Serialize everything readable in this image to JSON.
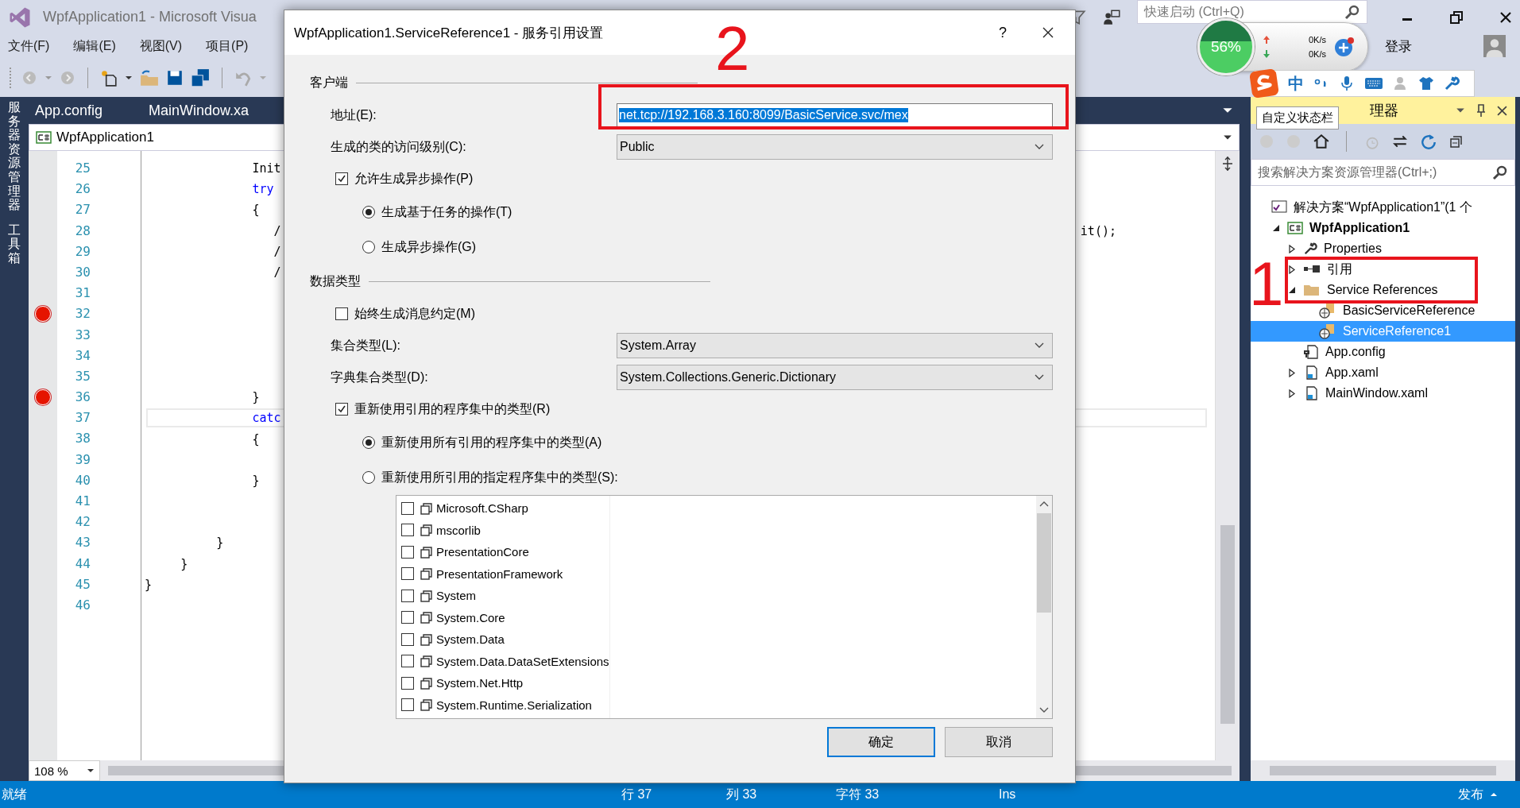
{
  "window": {
    "title": "WpfApplication1 - Microsoft Visua",
    "quick_launch": {
      "placeholder": "快速启动 (Ctrl+Q)"
    },
    "sign_in": "登录"
  },
  "menu": [
    "文件(F)",
    "编辑(E)",
    "视图(V)",
    "项目(P)"
  ],
  "side_tabs": [
    "服务器资源管理器",
    "工具箱"
  ],
  "editor": {
    "tabs": [
      "App.config",
      "MainWindow.xa"
    ],
    "breadcrumb": "WpfApplication1",
    "zoom": "108 %",
    "lines": [
      {
        "number": "25",
        "code": "               Init",
        "breakpoint": false
      },
      {
        "number": "26",
        "code": "               try",
        "keyword": true,
        "breakpoint": false
      },
      {
        "number": "27",
        "code": "               {",
        "breakpoint": false
      },
      {
        "number": "28",
        "code": "                  /",
        "tail": "it();",
        "breakpoint": false
      },
      {
        "number": "29",
        "code": "                  /",
        "breakpoint": false
      },
      {
        "number": "30",
        "code": "                  /",
        "breakpoint": false
      },
      {
        "number": "31",
        "breakpoint": false
      },
      {
        "number": "32",
        "breakpoint": true
      },
      {
        "number": "33",
        "breakpoint": false
      },
      {
        "number": "34",
        "breakpoint": false
      },
      {
        "number": "35",
        "breakpoint": false
      },
      {
        "number": "36",
        "code": "               }",
        "breakpoint": true
      },
      {
        "number": "37",
        "code": "               catc",
        "keyword": true,
        "current": true,
        "breakpoint": false
      },
      {
        "number": "38",
        "code": "               {",
        "breakpoint": false
      },
      {
        "number": "39",
        "breakpoint": false
      },
      {
        "number": "40",
        "code": "               }",
        "breakpoint": false
      },
      {
        "number": "41",
        "breakpoint": false
      },
      {
        "number": "42",
        "breakpoint": false
      },
      {
        "number": "43",
        "code": "          }",
        "current": false,
        "breakpoint": false
      },
      {
        "number": "44",
        "code": "     }",
        "breakpoint": false
      },
      {
        "number": "45",
        "code": "}",
        "breakpoint": false
      },
      {
        "number": "46",
        "breakpoint": false
      }
    ]
  },
  "solution_explorer": {
    "title": "理器",
    "search": {
      "placeholder": "搜索解决方案资源管理器(Ctrl+;)"
    },
    "tree": [
      {
        "label": "解决方案“WpfApplication1”(1 个",
        "kind": "solution",
        "selected": false,
        "children": [
          {
            "label": "WpfApplication1",
            "kind": "project",
            "expanded": true,
            "selected": false,
            "children": [
              {
                "label": "Properties",
                "kind": "properties",
                "expanded": false,
                "selected": false
              },
              {
                "label": "引用",
                "kind": "references",
                "expanded": false,
                "selected": false
              },
              {
                "label": "Service References",
                "kind": "folder",
                "expanded": true,
                "selected": false,
                "children": [
                  {
                    "label": "BasicServiceReference",
                    "kind": "service",
                    "selected": false
                  },
                  {
                    "label": "ServiceReference1",
                    "kind": "service",
                    "selected": true
                  }
                ]
              },
              {
                "label": "App.config",
                "kind": "config",
                "selected": false
              },
              {
                "label": "App.xaml",
                "kind": "xaml",
                "expanded": false,
                "selected": false
              },
              {
                "label": "MainWindow.xaml",
                "kind": "xaml",
                "expanded": false,
                "selected": false
              }
            ]
          }
        ]
      }
    ]
  },
  "tooltip": "自定义状态栏",
  "net_widget": {
    "percent": "56%",
    "up": "0K/s",
    "down": "0K/s"
  },
  "ime_bar": {
    "mode": "中"
  },
  "dialog": {
    "title": "WpfApplication1.ServiceReference1 - 服务引用设置",
    "help": "?",
    "rows": [
      {
        "kind": "section",
        "label": "客户端"
      },
      {
        "kind": "field",
        "label": "地址(E):",
        "value": "net.tcp://192.168.3.160:8099/BasicService.svc/mex",
        "highlighted": true
      },
      {
        "kind": "dropdown",
        "label": "生成的类的访问级别(C):",
        "value": "Public"
      },
      {
        "kind": "checkbox",
        "label": "允许生成异步操作(P)",
        "checked": true
      },
      {
        "kind": "radio",
        "label": "生成基于任务的操作(T)",
        "selected": true
      },
      {
        "kind": "radio",
        "label": "生成异步操作(G)",
        "selected": false
      },
      {
        "kind": "section",
        "label": "数据类型"
      },
      {
        "kind": "checkbox",
        "label": "始终生成消息约定(M)",
        "checked": false
      },
      {
        "kind": "dropdown",
        "label": "集合类型(L):",
        "value": "System.Array"
      },
      {
        "kind": "dropdown",
        "label": "字典集合类型(D):",
        "value": "System.Collections.Generic.Dictionary"
      },
      {
        "kind": "checkbox",
        "label": "重新使用引用的程序集中的类型(R)",
        "checked": true
      },
      {
        "kind": "radio",
        "label": "重新使用所有引用的程序集中的类型(A)",
        "selected": true
      },
      {
        "kind": "radio",
        "label": "重新使用所引用的指定程序集中的类型(S):",
        "selected": false
      }
    ],
    "assemblies": [
      {
        "name": "Microsoft.CSharp",
        "checked": false
      },
      {
        "name": "mscorlib",
        "checked": false
      },
      {
        "name": "PresentationCore",
        "checked": false
      },
      {
        "name": "PresentationFramework",
        "checked": false
      },
      {
        "name": "System",
        "checked": false
      },
      {
        "name": "System.Core",
        "checked": false
      },
      {
        "name": "System.Data",
        "checked": false
      },
      {
        "name": "System.Data.DataSetExtensions",
        "checked": false
      },
      {
        "name": "System.Net.Http",
        "checked": false
      },
      {
        "name": "System.Runtime.Serialization",
        "checked": false
      }
    ],
    "buttons": [
      {
        "label": "确定",
        "default": true
      },
      {
        "label": "取消",
        "default": false
      }
    ]
  },
  "annotations": [
    {
      "label": "2",
      "kind": "address-frame"
    },
    {
      "label": "1",
      "kind": "tree-frame"
    }
  ],
  "status_bar": {
    "state": "就绪",
    "line": "行 37",
    "column": "列 33",
    "char": "字符 33",
    "mode": "Ins",
    "publish": "发布"
  }
}
